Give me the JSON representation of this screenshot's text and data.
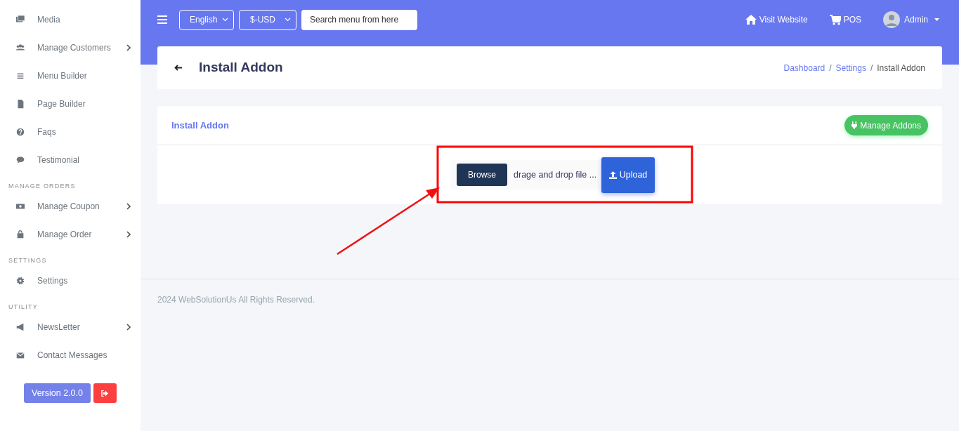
{
  "sidebar": {
    "items": [
      {
        "kind": "item",
        "label": "Media",
        "expandable": false
      },
      {
        "kind": "item",
        "label": "Manage Customers",
        "expandable": true
      },
      {
        "kind": "item",
        "label": "Menu Builder",
        "expandable": false
      },
      {
        "kind": "item",
        "label": "Page Builder",
        "expandable": false
      },
      {
        "kind": "item",
        "label": "Faqs",
        "expandable": false
      },
      {
        "kind": "item",
        "label": "Testimonial",
        "expandable": false
      },
      {
        "kind": "header",
        "label": "MANAGE ORDERS"
      },
      {
        "kind": "item",
        "label": "Manage Coupon",
        "expandable": true
      },
      {
        "kind": "item",
        "label": "Manage Order",
        "expandable": true
      },
      {
        "kind": "header",
        "label": "SETTINGS"
      },
      {
        "kind": "item",
        "label": "Settings",
        "expandable": false
      },
      {
        "kind": "header",
        "label": "UTILITY"
      },
      {
        "kind": "item",
        "label": "NewsLetter",
        "expandable": true
      },
      {
        "kind": "item",
        "label": "Contact Messages",
        "expandable": false
      }
    ],
    "version": "Version 2.0.0"
  },
  "topbar": {
    "language": "English",
    "currency": "$-USD",
    "search": {
      "placeholder": "Search menu from here"
    },
    "visit_website": "Visit Website",
    "pos": "POS",
    "user": "Admin"
  },
  "page_header": {
    "title": "Install Addon",
    "breadcrumb": [
      {
        "label": "Dashboard",
        "link": true
      },
      {
        "separator": "/"
      },
      {
        "label": "Settings",
        "link": true
      },
      {
        "separator": "/"
      },
      {
        "label": "Install Addon",
        "link": false
      }
    ]
  },
  "card": {
    "title": "Install Addon",
    "manage_button": "Manage Addons",
    "browse": "Browse",
    "file_placeholder": "drage and drop file ...",
    "upload": "Upload"
  },
  "footer": "2024 WebSolutionUs All Rights Reserved."
}
